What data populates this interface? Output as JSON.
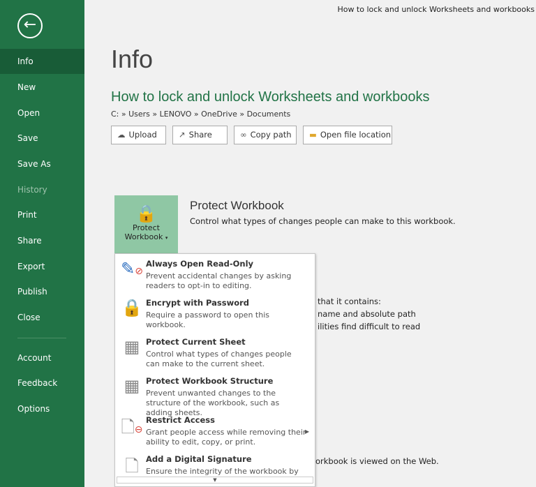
{
  "window_title": "How to lock and unlock Worksheets and workbooks",
  "sidebar": {
    "items": [
      {
        "label": "Info",
        "active": true
      },
      {
        "label": "New"
      },
      {
        "label": "Open"
      },
      {
        "label": "Save"
      },
      {
        "label": "Save As"
      },
      {
        "label": "History",
        "disabled": true
      },
      {
        "label": "Print"
      },
      {
        "label": "Share"
      },
      {
        "label": "Export"
      },
      {
        "label": "Publish"
      },
      {
        "label": "Close"
      },
      {
        "label": "Account"
      },
      {
        "label": "Feedback"
      },
      {
        "label": "Options"
      }
    ]
  },
  "page": {
    "title": "Info",
    "doc_title": "How to lock and unlock Worksheets and workbooks",
    "breadcrumb": "C: » Users » LENOVO » OneDrive » Documents"
  },
  "buttons": {
    "upload": "Upload",
    "share": "Share",
    "copy_path": "Copy path",
    "open_location": "Open file location"
  },
  "protect": {
    "button_line1": "Protect",
    "button_line2": "Workbook",
    "title": "Protect Workbook",
    "desc": "Control what types of changes people can make to this workbook."
  },
  "background_text": [
    "that it contains:",
    "name and absolute path",
    "ilities find difficult to read",
    "orkbook is viewed on the Web."
  ],
  "menu": [
    {
      "title": "Always Open Read-Only",
      "desc": "Prevent accidental changes by asking readers to opt-in to editing.",
      "icon": "pencil-no-icon"
    },
    {
      "title": "Encrypt with Password",
      "desc": "Require a password to open this workbook.",
      "icon": "lock-key-icon"
    },
    {
      "title": "Protect Current Sheet",
      "desc": "Control what types of changes people can make to the current sheet.",
      "icon": "sheet-lock-icon"
    },
    {
      "title": "Protect Workbook Structure",
      "desc": "Prevent unwanted changes to the structure of the workbook, such as adding sheets.",
      "icon": "sheet-lock-icon"
    },
    {
      "title": "Restrict Access",
      "desc": "Grant people access while removing their ability to edit, copy, or print.",
      "icon": "document-restrict-icon",
      "submenu": true
    },
    {
      "title": "Add a Digital Signature",
      "desc": "Ensure the integrity of the workbook by",
      "icon": "document-ribbon-icon"
    }
  ],
  "colors": {
    "sidebar": "#217346",
    "accent": "#217346",
    "protect_button": "#8fc7a4"
  }
}
